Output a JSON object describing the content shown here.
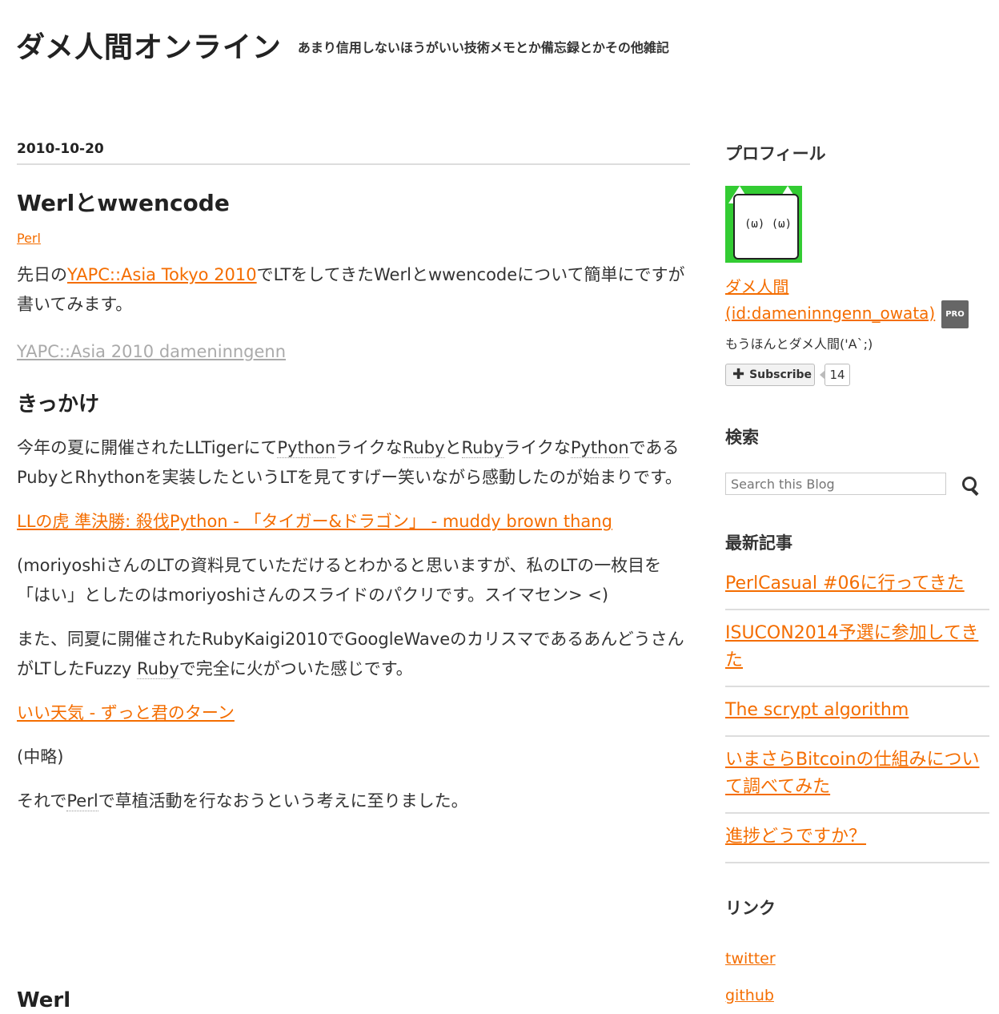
{
  "header": {
    "title": "ダメ人間オンライン",
    "description": "あまり信用しないほうがいい技術メモとか備忘録とかその他雑記"
  },
  "entry": {
    "date": "2010-10-20",
    "title": "Werlとwwencode",
    "category": "Perl",
    "p1_before": "先日の",
    "p1_link": "YAPC::Asia Tokyo 2010",
    "p1_after": "でLTをしてきたWerlとwwencodeについて簡単にですが書いてみます。",
    "embed_link": "YAPC::Asia 2010 dameninngenn",
    "section1_heading": "きっかけ",
    "p2": {
      "a": "今年の夏に開催されたLLTigerにて",
      "k1": "Python",
      "b": "ライクな",
      "k2": "Ruby",
      "c": "と",
      "k3": "Ruby",
      "d": "ライクな",
      "k4": "Python",
      "e": "であるPubyとRhythonを実装したというLTを見てすげー笑いながら感動したのが始まりです。"
    },
    "link1": "LLの虎 準決勝: 殺伐Python - 「タイガー&ドラゴン」 - muddy brown thang",
    "p3": "(moriyoshiさんのLTの資料見ていただけるとわかると思いますが、私のLTの一枚目を「はい」としたのはmoriyoshiさんのスライドのパクリです。スイマセン> <)",
    "p4": {
      "a": "また、同夏に開催されたRubyKaigi2010でGoogleWaveのカリスマであるあんどうさんがLTしたFuzzy ",
      "k1": "Ruby",
      "b": "で完全に火がついた感じです。"
    },
    "link2": "いい天気 - ずっと君のターン",
    "p5": "(中略)",
    "p6": {
      "a": "それで",
      "k1": "Perl",
      "b": "で草植活動を行なおうという考えに至りました。"
    },
    "section2_heading": "Werl"
  },
  "sidebar": {
    "profile_heading": "プロフィール",
    "profile_name": "ダメ人間",
    "profile_id": "(id:dameninngenn_owata)",
    "pro_badge": "PRO",
    "profile_desc": "もうほんとダメ人間('A`;)",
    "subscribe_label": "Subscribe",
    "subscribe_count": "14",
    "search_heading": "検索",
    "search_placeholder": "Search this Blog",
    "recent_heading": "最新記事",
    "recent": [
      "PerlCasual #06に行ってきた",
      "ISUCON2014予選に参加してきた",
      "The scrypt algorithm",
      "いまさらBitcoinの仕組みについて調べてみた",
      "進捗どうですか？"
    ],
    "links_heading": "リンク",
    "links": [
      "twitter",
      "github"
    ]
  },
  "colors": {
    "link": "#f46d00",
    "text": "#333333",
    "rule": "#dddddd"
  },
  "icons": {
    "search": "search-icon",
    "subscribe": "plus-icon",
    "avatar": "cat-face-avatar"
  }
}
